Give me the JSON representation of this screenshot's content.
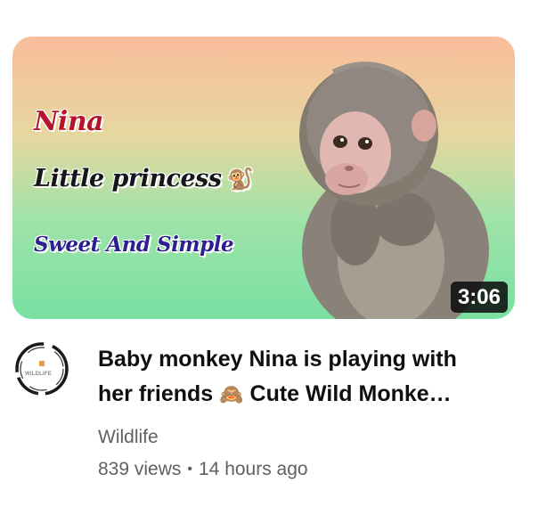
{
  "thumbnail": {
    "line1": "Nina",
    "line2": "Little princess",
    "line2_emoji": "🐒",
    "line3": "Sweet And Simple",
    "duration": "3:06",
    "gradient_colors": [
      "#f9bd9b",
      "#e6d79f",
      "#9fe3a8",
      "#79e0a2"
    ]
  },
  "video": {
    "title_line1": "Baby monkey Nina is playing with",
    "title_line2_prefix": "her friends",
    "title_emoji": "🙈",
    "title_line2_suffix": "Cute Wild Monke…",
    "channel": "Wildlife",
    "views": "839 views",
    "separator": "•",
    "age": "14 hours ago"
  },
  "avatar": {
    "label": "WILDLIFE",
    "icon": "wildlife-logo-icon"
  },
  "colors": {
    "title": "#0f0f0f",
    "meta": "#606060",
    "duration_bg": "#0a0a0a"
  }
}
